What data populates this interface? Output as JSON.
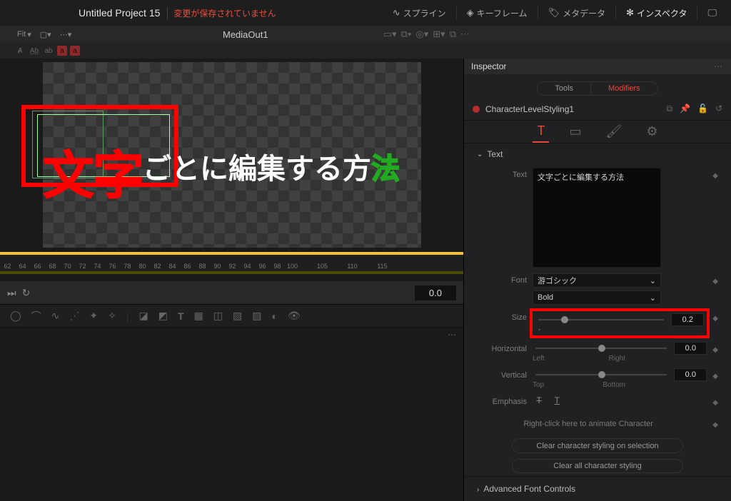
{
  "top": {
    "project": "Untitled Project 15",
    "unsaved": "変更が保存されていません",
    "tabs": {
      "spline": "スプライン",
      "keyframe": "キーフレーム",
      "metadata": "メタデータ",
      "inspector": "インスペクタ"
    }
  },
  "viewer": {
    "fit": "Fit",
    "node": "MediaOut1"
  },
  "inspector": {
    "title": "Inspector",
    "tabs": {
      "tools": "Tools",
      "modifiers": "Modifiers"
    },
    "node": "CharacterLevelStyling1",
    "section_text": "Text",
    "text_label": "Text",
    "text_value": "文字ごとに編集する方法",
    "font_label": "Font",
    "font_value": "游ゴシック",
    "weight_value": "Bold",
    "size_label": "Size",
    "size_value": "0.2",
    "horiz_label": "Horizontal",
    "horiz_left": "Left",
    "horiz_right": "Right",
    "horiz_value": "0.0",
    "vert_label": "Vertical",
    "vert_top": "Top",
    "vert_bottom": "Bottom",
    "vert_value": "0.0",
    "emph_label": "Emphasis",
    "anim_hint": "Right-click here to animate Character",
    "clear_sel": "Clear character styling on selection",
    "clear_all": "Clear all character styling",
    "adv": "Advanced Font Controls"
  },
  "transport": {
    "tc": "0.0"
  },
  "ruler": [
    "62",
    "64",
    "66",
    "68",
    "70",
    "72",
    "74",
    "76",
    "78",
    "80",
    "82",
    "84",
    "86",
    "88",
    "90",
    "92",
    "94",
    "96",
    "98",
    "100",
    "",
    "105",
    "",
    "110",
    "",
    "115"
  ],
  "canvas_text": {
    "big": "文字",
    "rest1": "ごとに編集する方",
    "ho": "法"
  }
}
